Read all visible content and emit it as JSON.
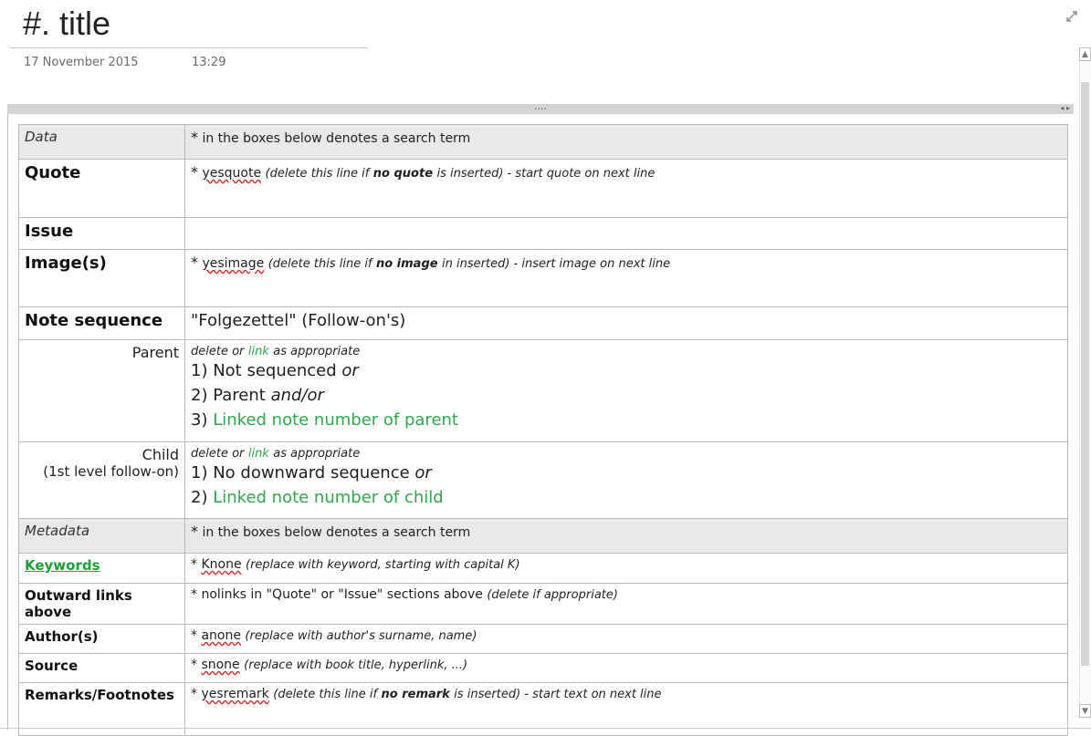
{
  "page": {
    "title": "#. title",
    "date": "17 November 2015",
    "time": "13:29",
    "handle_dots": "....",
    "handle_arrows": "◂ ▸"
  },
  "icons": {
    "expand": "expand-icon",
    "scroll_up": "chevron-up-icon",
    "scroll_down": "chevron-down-icon"
  },
  "table": {
    "data_header": {
      "label": "Data",
      "star": "*",
      "text": "in the boxes below denotes a search term"
    },
    "quote": {
      "label": "Quote",
      "star": "*",
      "keyword": "yesquote",
      "note_a": "(delete this line if",
      "note_b": "no quote",
      "note_c": "is inserted) - start quote on next line"
    },
    "issue": {
      "label": "Issue"
    },
    "image": {
      "label": "Image(s)",
      "star": "*",
      "keyword": "yesimage",
      "note_a": "(delete this line if",
      "note_b": "no image",
      "note_c": "in inserted) - insert image on next line"
    },
    "note_sequence": {
      "label": "Note sequence",
      "value": "\"Folgezettel\" (Follow-on's)"
    },
    "parent": {
      "label": "Parent",
      "instr_a": "delete or",
      "instr_link": "link",
      "instr_b": "as appropriate",
      "line1_a": "1) Not sequenced",
      "line1_b": "or",
      "line2_a": "2) Parent",
      "line2_b": "and/or",
      "line3_a": "3)",
      "line3_b": "Linked note number of parent"
    },
    "child": {
      "label1": "Child",
      "label2": "(1st level follow-on)",
      "instr_a": "delete or",
      "instr_link": "link",
      "instr_b": "as appropriate",
      "line1_a": "1) No downward sequence",
      "line1_b": "or",
      "line2_a": "2)",
      "line2_b": "Linked note number of child"
    },
    "metadata_header": {
      "label": "Metadata",
      "star": "*",
      "text": "in the boxes below denotes a search term"
    },
    "keywords": {
      "label": "Keywords",
      "star": "*",
      "keyword": "Knone",
      "note": "(replace with keyword, starting with capital K)"
    },
    "outward_links": {
      "label": "Outward links above",
      "text": "* nolinks in \"Quote\" or \"Issue\" sections above",
      "note": "(delete if appropriate)"
    },
    "authors": {
      "label": "Author(s)",
      "star": "*",
      "keyword": "anone",
      "note": "(replace with author's surname, name)"
    },
    "source": {
      "label": "Source",
      "star": "*",
      "keyword": "snone",
      "note": "(replace with book title, hyperlink, ...)"
    },
    "remarks": {
      "label": "Remarks/Footnotes",
      "star": "*",
      "keyword": "yesremark",
      "note_a": "(delete this line if",
      "note_b": "no remark",
      "note_c": "is inserted) - start text on next line"
    }
  }
}
